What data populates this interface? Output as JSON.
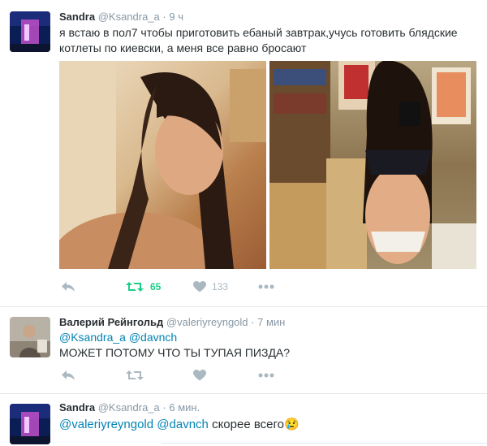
{
  "tweets": [
    {
      "name": "Sandra",
      "handle": "@Ksandra_a",
      "time": "9 ч",
      "text": "я встаю в пол7 чтобы приготовить ебаный завтрак,учусь готовить блядские котлеты по киевски, а меня все равно бросают",
      "photos": [
        "photo-1",
        "photo-2"
      ],
      "retweets": "65",
      "likes": "133"
    },
    {
      "name": "Валерий Рейнгольд",
      "handle": "@valeriyreyngold",
      "time": "7 мин",
      "mentions": [
        "@Ksandra_a",
        "@davnch"
      ],
      "text": "МОЖЕТ ПОТОМУ ЧТО ТЫ ТУПАЯ ПИЗДА?"
    },
    {
      "name": "Sandra",
      "handle": "@Ksandra_a",
      "time": "6 мин.",
      "mentions": [
        "@valeriyreyngold",
        "@davnch"
      ],
      "text": "скорее всего",
      "emoji": "😢"
    }
  ],
  "dot": "·",
  "colors": {
    "link": "#0084b4",
    "retweet_active": "#19cf86",
    "muted": "#aab8c2",
    "border": "#e1e8ed"
  }
}
